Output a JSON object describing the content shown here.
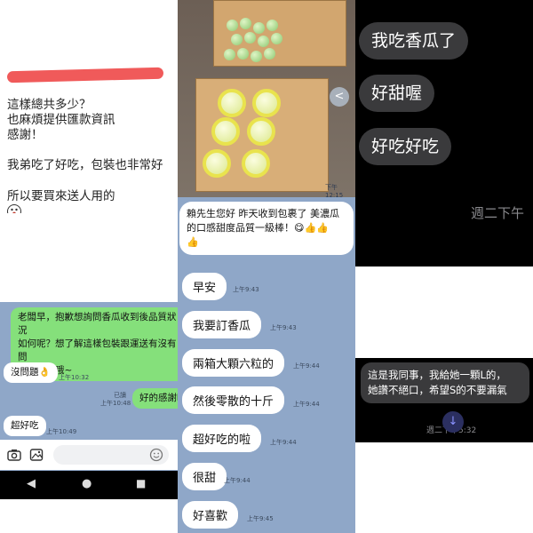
{
  "panel1": {
    "line1": "這樣總共多少？",
    "line2": "也麻煩提供匯款資訊",
    "line3": "感謝！",
    "line4": "我弟吃了好吃，包裝也非常好",
    "line5": "所以要買來送人用的"
  },
  "panel2": {
    "msg1": "老闆早，抱歉想詢問香瓜收到後品質狀況\n如何呢？想了解這樣包裝跟運送有沒有問\n題，謝謝哦~",
    "msg2": "沒問題👌",
    "msg2_time": "上午10:32",
    "msg3_read": "已讀",
    "msg3_time": "上午10:48",
    "msg3": "好的感謝喔",
    "msg4": "超好吃",
    "msg4_time": "上午10:49",
    "nav_back": "◀",
    "nav_home": "●",
    "nav_recent": "■"
  },
  "panel3": {
    "photo_time": "下午12:15",
    "share_icon": "<",
    "review": "賴先生您好 昨天收到包裹了 美濃瓜\n的口感甜度品質一級棒！😋👍👍\n👍",
    "msgs": [
      {
        "text": "早安",
        "time": "上午9:43"
      },
      {
        "text": "我要訂香瓜",
        "time": "上午9:43"
      },
      {
        "text": "兩箱大顆六粒的",
        "time": "上午9:44"
      },
      {
        "text": "然後零散的十斤",
        "time": "上午9:44"
      },
      {
        "text": "超好吃的啦",
        "time": "上午9:44"
      },
      {
        "text": "很甜",
        "time": "上午9:44"
      },
      {
        "text": "好喜歡",
        "time": "上午9:45"
      }
    ]
  },
  "panel4": {
    "msg1": "我吃香瓜了",
    "msg2": "好甜喔",
    "msg3": "好吃好吃",
    "time": "週二下午"
  },
  "panel5": {
    "msg": "這是我同事，我給她一顆L的，\n她讚不絕口，希望S的不要漏氣",
    "time": "週二下午5:32",
    "scroll_icon": "↓"
  }
}
